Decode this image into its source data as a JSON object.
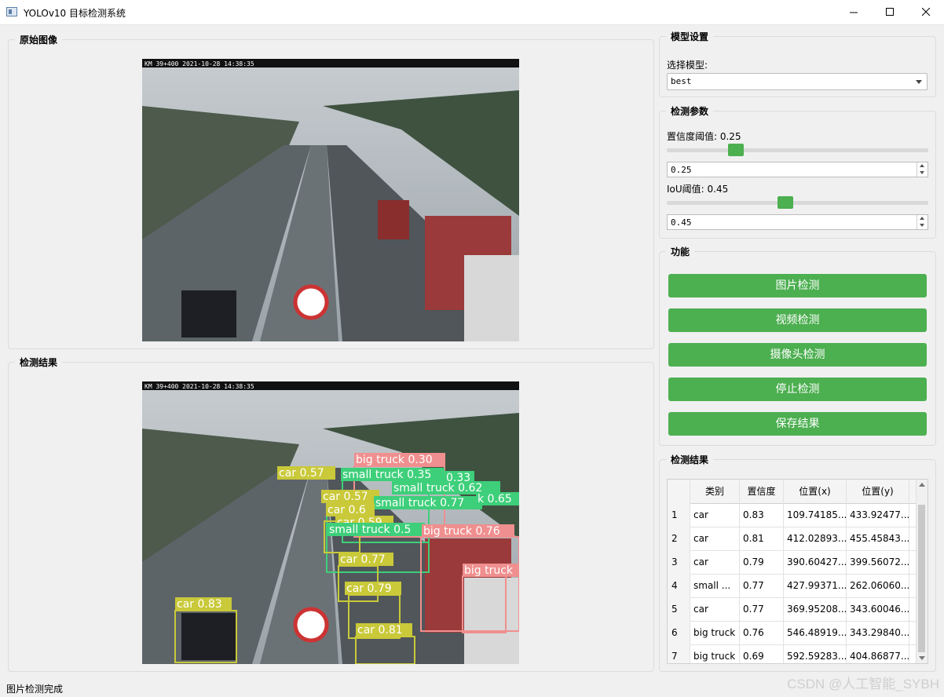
{
  "window": {
    "title": "YOLOv10 目标检测系统"
  },
  "original_group": {
    "title": "原始图像"
  },
  "result_group": {
    "title": "检测结果"
  },
  "camera_overlay": "KM 39+400  2021-10-28 14:38:35",
  "model_settings": {
    "title": "模型设置",
    "select_label": "选择模型:",
    "selected_model": "best"
  },
  "params": {
    "title": "检测参数",
    "conf_label": "置信度阈值: 0.25",
    "conf_value": "0.25",
    "conf_level": 0.25,
    "iou_label": "IoU阈值: 0.45",
    "iou_value": "0.45",
    "iou_level": 0.45
  },
  "functions": {
    "title": "功能",
    "buttons": [
      "图片检测",
      "视频检测",
      "摄像头检测",
      "停止检测",
      "保存结果"
    ]
  },
  "results_table": {
    "title": "检测结果",
    "columns": [
      "类别",
      "置信度",
      "位置(x)",
      "位置(y)"
    ],
    "rows": [
      [
        "1",
        "car",
        "0.83",
        "109.74185...",
        "433.92477..."
      ],
      [
        "2",
        "car",
        "0.81",
        "412.02893...",
        "455.45843..."
      ],
      [
        "3",
        "car",
        "0.79",
        "390.60427...",
        "399.56072..."
      ],
      [
        "4",
        "small ...",
        "0.77",
        "427.99371...",
        "262.06060..."
      ],
      [
        "5",
        "car",
        "0.77",
        "369.95208...",
        "343.60046..."
      ],
      [
        "6",
        "big truck",
        "0.76",
        "546.48919...",
        "343.29840..."
      ],
      [
        "7",
        "big truck",
        "0.69",
        "592.59283...",
        "404.86877..."
      ]
    ]
  },
  "detections": [
    {
      "label": "big truck 0.30"
    },
    {
      "label": "small truck 0.35"
    },
    {
      "label": "0.33"
    },
    {
      "label": "small truck 0.62"
    },
    {
      "label": "car 0.57"
    },
    {
      "label": "car 0.57"
    },
    {
      "label": "small truck 0.77"
    },
    {
      "label": "k 0.65"
    },
    {
      "label": "car 0.6"
    },
    {
      "label": "car 0.59"
    },
    {
      "label": "small truck 0.5"
    },
    {
      "label": "big truck 0.76"
    },
    {
      "label": "car 0.77"
    },
    {
      "label": "big truck"
    },
    {
      "label": "car 0.79"
    },
    {
      "label": "car 0.83"
    },
    {
      "label": "car 0.81"
    }
  ],
  "status": {
    "text": "图片检测完成"
  },
  "watermark": "CSDN @人工智能_SYBH",
  "colors": {
    "accent": "#4caf50",
    "car_box": "#c9c93a",
    "small_truck_box": "#3ecf7a",
    "big_truck_box": "#f08f8f"
  }
}
